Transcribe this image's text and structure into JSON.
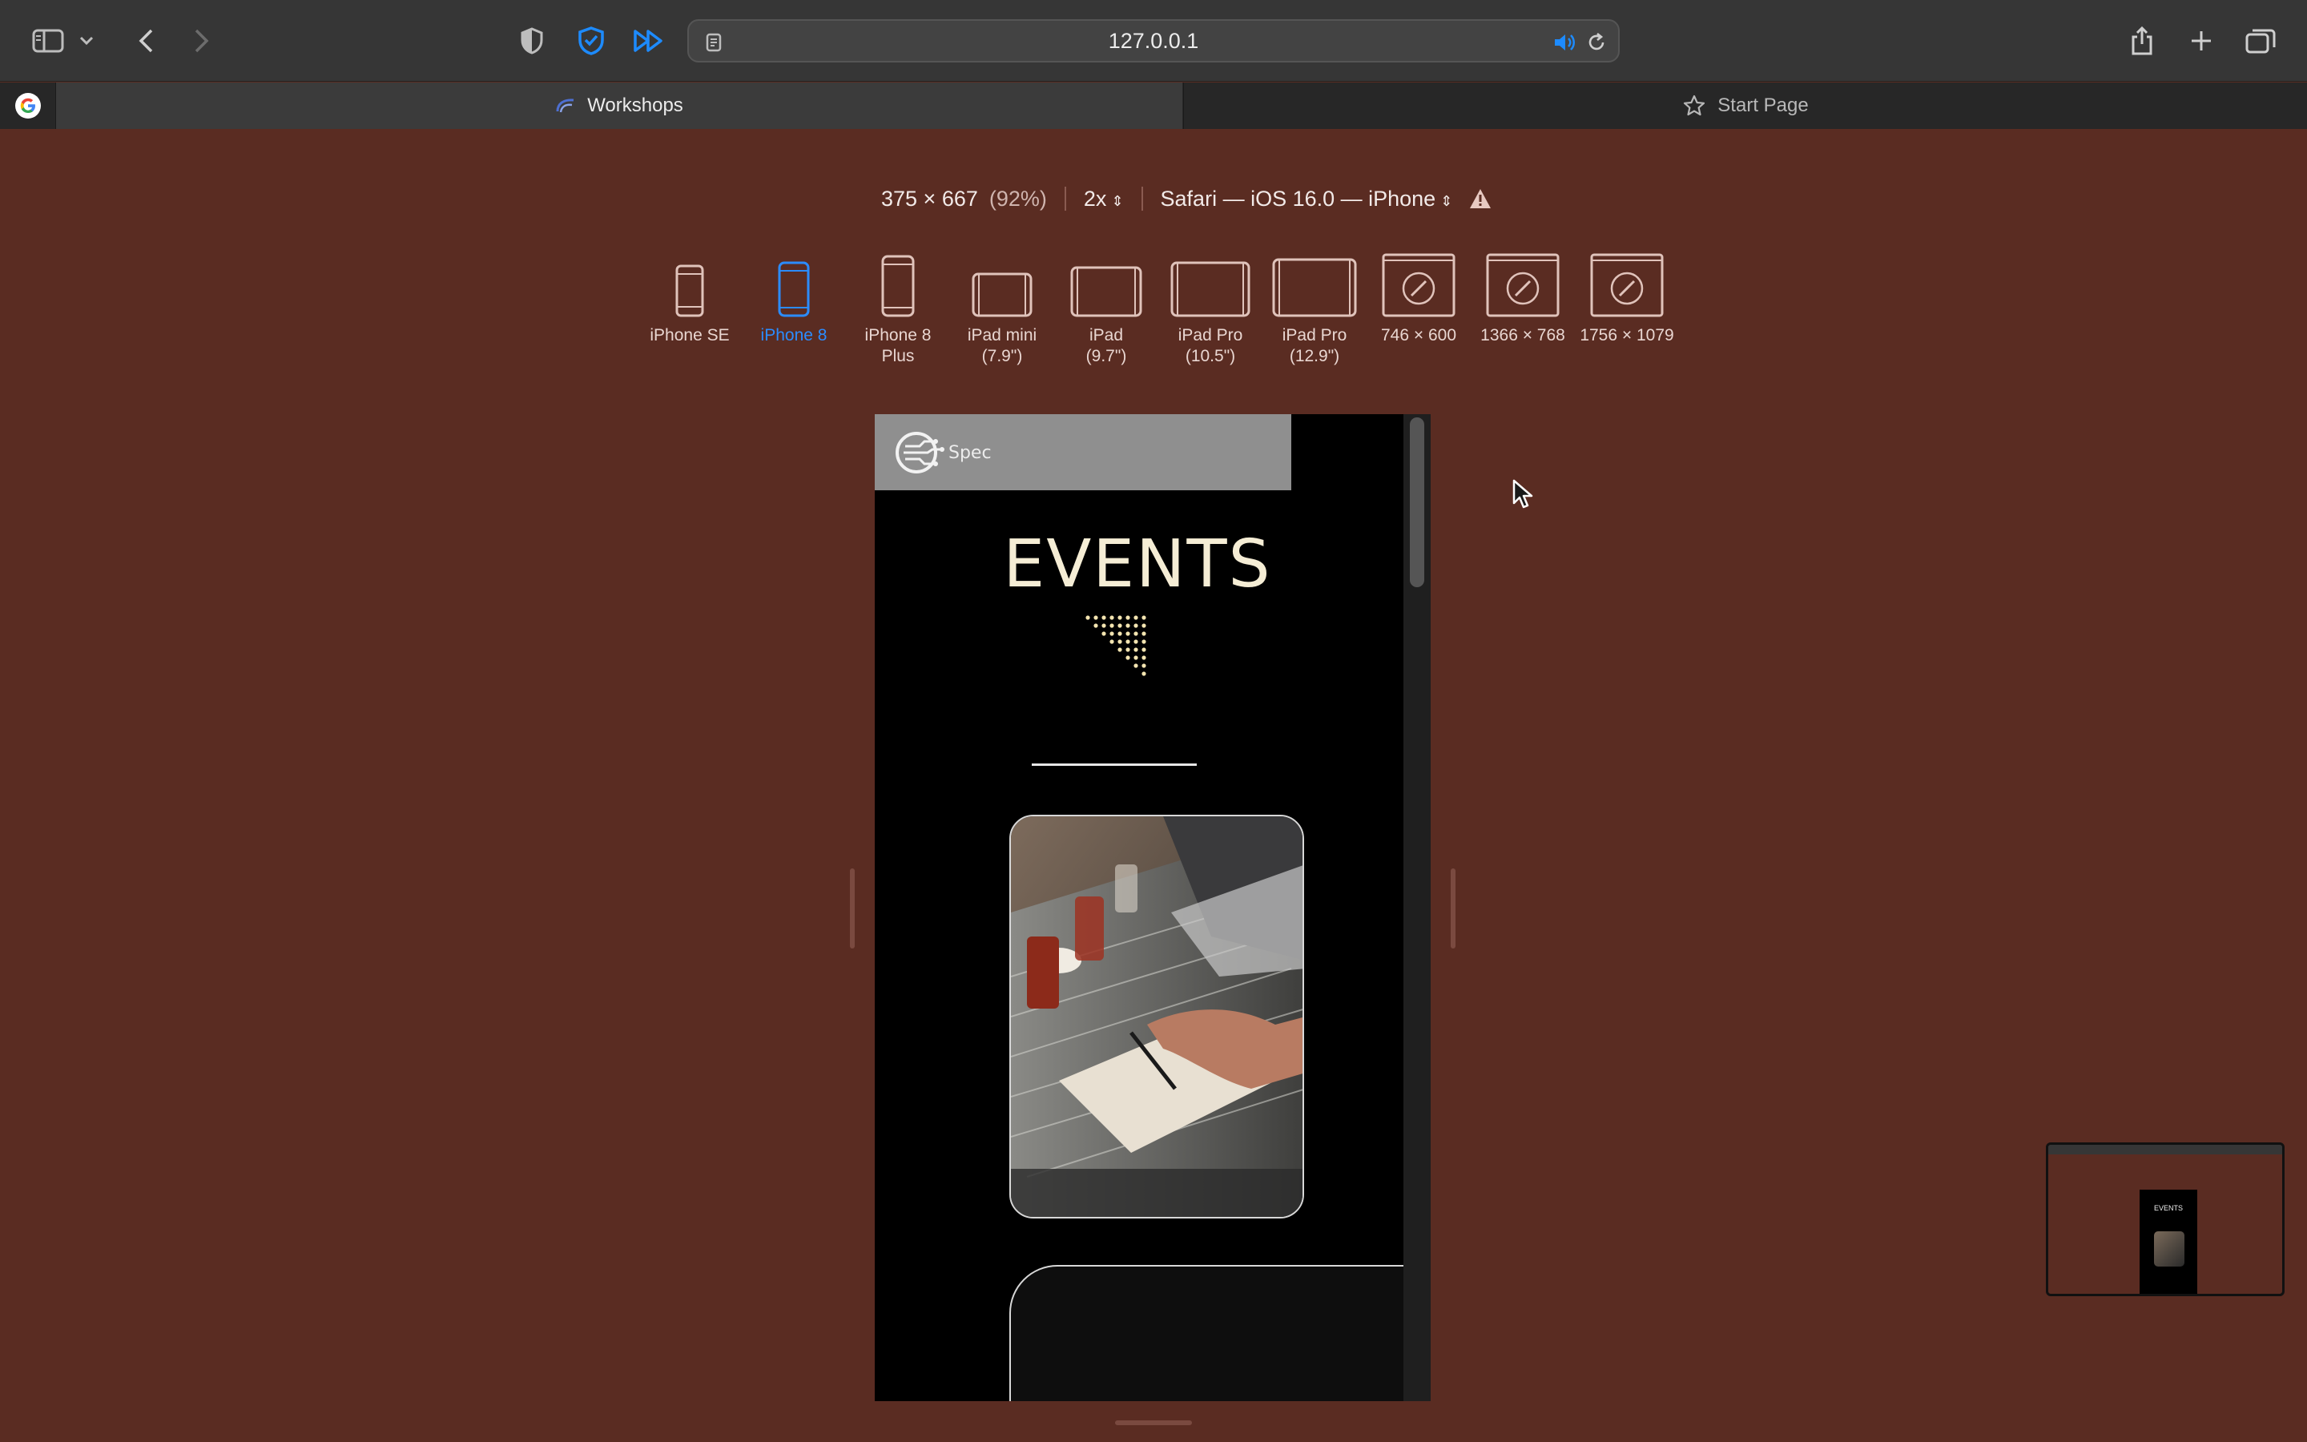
{
  "browser": {
    "url": "127.0.0.1",
    "tabs": [
      {
        "label": "Workshops"
      },
      {
        "label": "Start Page"
      }
    ]
  },
  "rdm": {
    "dimensions": "375 × 667",
    "zoom_percent": "(92%)",
    "pixel_ratio": "2x",
    "user_agent": "Safari — iOS 16.0 — iPhone",
    "devices": [
      {
        "name": "iPhone SE",
        "sub": ""
      },
      {
        "name": "iPhone 8",
        "sub": "",
        "selected": true
      },
      {
        "name": "iPhone 8",
        "sub": "Plus"
      },
      {
        "name": "iPad mini",
        "sub": "(7.9\")"
      },
      {
        "name": "iPad",
        "sub": "(9.7\")"
      },
      {
        "name": "iPad Pro",
        "sub": "(10.5\")"
      },
      {
        "name": "iPad Pro",
        "sub": "(12.9\")"
      },
      {
        "name": "746 × 600",
        "sub": ""
      },
      {
        "name": "1366 × 768",
        "sub": ""
      },
      {
        "name": "1756 × 1079",
        "sub": ""
      }
    ]
  },
  "page": {
    "logo_text": "Spec",
    "heading": "EVENTS"
  },
  "colors": {
    "background": "#5a2c22",
    "selected_device": "#2b8cff",
    "heading": "#f5edd5"
  }
}
